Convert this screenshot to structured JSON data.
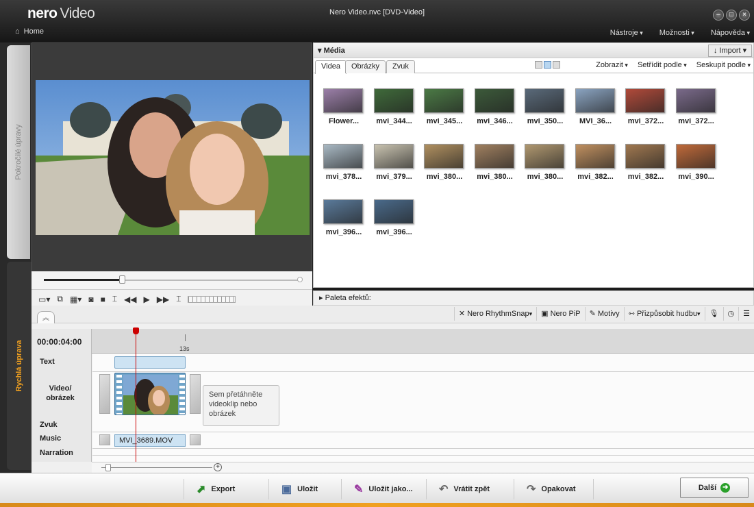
{
  "app": {
    "brand_bold": "nero",
    "brand_light": "Video",
    "window_title": "Nero Video.nvc [DVD-Video]",
    "home": "Home",
    "menu": [
      "Nástroje",
      "Možnosti",
      "Nápověda"
    ]
  },
  "side_tabs": {
    "advanced": "Pokročilé úpravy",
    "quick": "Rychlá úprava"
  },
  "media": {
    "title": "Média",
    "import": "Import",
    "tabs": [
      "Videa",
      "Obrázky",
      "Zvuk"
    ],
    "view_menu": [
      "Zobrazit",
      "Setřídit podle",
      "Seskupit podle"
    ],
    "items": [
      {
        "name": "Flower...",
        "color": "#9b7fa8"
      },
      {
        "name": "mvi_344...",
        "color": "#3f6a3a"
      },
      {
        "name": "mvi_345...",
        "color": "#4b7a45"
      },
      {
        "name": "mvi_346...",
        "color": "#3c5a3a"
      },
      {
        "name": "mvi_350...",
        "color": "#5a6a7a"
      },
      {
        "name": "MVI_36...",
        "color": "#8aa3c0"
      },
      {
        "name": "mvi_372...",
        "color": "#b04a3a"
      },
      {
        "name": "mvi_372...",
        "color": "#7a6a8a"
      },
      {
        "name": "mvi_378...",
        "color": "#a9b9c4"
      },
      {
        "name": "mvi_379...",
        "color": "#c9c3b0"
      },
      {
        "name": "mvi_380...",
        "color": "#b09060"
      },
      {
        "name": "mvi_380...",
        "color": "#a08060"
      },
      {
        "name": "mvi_380...",
        "color": "#b09870"
      },
      {
        "name": "mvi_382...",
        "color": "#c09060"
      },
      {
        "name": "mvi_382...",
        "color": "#a07850"
      },
      {
        "name": "mvi_390...",
        "color": "#c06a3a"
      },
      {
        "name": "mvi_396...",
        "color": "#5a7a9a"
      },
      {
        "name": "mvi_396...",
        "color": "#4a6a8a"
      }
    ]
  },
  "effects_label": "Paleta efektů:",
  "timeline_tools": [
    "Nero RhythmSnap",
    "Nero PiP",
    "Motivy",
    "Přizpůsobit hudbu"
  ],
  "timeline": {
    "timecode": "00:00:04:00",
    "tick": "13s",
    "tracks": [
      "Text",
      "Video/ obrázek",
      "Zvuk",
      "Music",
      "Narration"
    ],
    "audio_clip": "MVI_3689.MOV",
    "drop_hint": "Sem přetáhněte videoklip nebo obrázek"
  },
  "bottom": {
    "export": "Export",
    "save": "Uložit",
    "save_as": "Uložit jako...",
    "undo": "Vrátit zpět",
    "redo": "Opakovat",
    "next": "Další"
  },
  "colors": {
    "accent": "#f0a020",
    "playhead": "#cc0000",
    "clip": "#cde3f3"
  }
}
